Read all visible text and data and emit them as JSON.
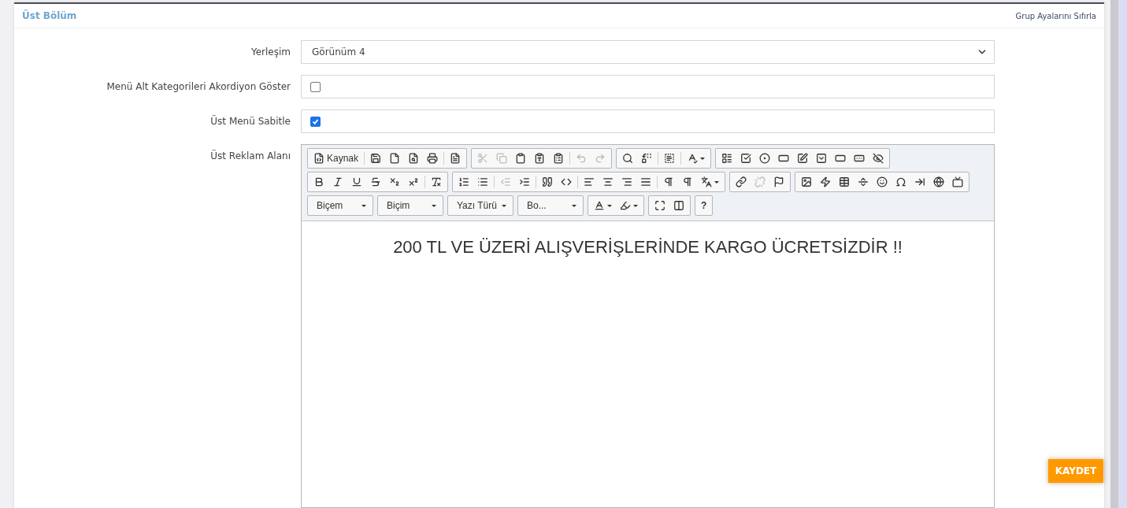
{
  "panel": {
    "title": "Üst Bölüm",
    "reset_link": "Grup Ayalarını Sıfırla"
  },
  "fields": [
    {
      "kind": "select",
      "label": "Yerleşim",
      "value": "Görünüm 4"
    },
    {
      "kind": "checkbox",
      "label": "Menü Alt Kategorileri Akordiyon Göster",
      "checked": false
    },
    {
      "kind": "checkbox",
      "label": "Üst Menü Sabitle",
      "checked": true
    },
    {
      "kind": "editor",
      "label": "Üst Reklam Alanı",
      "content": "200 TL VE ÜZERİ ALIŞVERİŞLERİNDE KARGO ÜCRETSİZDİR !!"
    }
  ],
  "toolbar_rows": [
    [
      [
        {
          "kind": "source",
          "label": "Kaynak",
          "disabled": false
        },
        {
          "kind": "sep"
        },
        {
          "kind": "save",
          "disabled": false
        },
        {
          "kind": "newpage",
          "disabled": false
        },
        {
          "kind": "preview",
          "disabled": false
        },
        {
          "kind": "print",
          "disabled": false
        },
        {
          "kind": "sep"
        },
        {
          "kind": "templates",
          "disabled": false
        }
      ],
      [
        {
          "kind": "cut",
          "disabled": true
        },
        {
          "kind": "copy",
          "disabled": true
        },
        {
          "kind": "paste",
          "disabled": false
        },
        {
          "kind": "pastetext",
          "disabled": false
        },
        {
          "kind": "pasteword",
          "disabled": false
        },
        {
          "kind": "sep"
        },
        {
          "kind": "undo",
          "disabled": true
        },
        {
          "kind": "redo",
          "disabled": true
        }
      ],
      [
        {
          "kind": "find",
          "disabled": false
        },
        {
          "kind": "replace",
          "disabled": false
        },
        {
          "kind": "sep"
        },
        {
          "kind": "selectall",
          "disabled": false
        },
        {
          "kind": "sep"
        },
        {
          "kind": "spellcheck",
          "disabled": false
        }
      ],
      [
        {
          "kind": "form",
          "disabled": false
        },
        {
          "kind": "checkbox",
          "disabled": false
        },
        {
          "kind": "radio",
          "disabled": false
        },
        {
          "kind": "textfield",
          "disabled": false
        },
        {
          "kind": "textarea",
          "disabled": false
        },
        {
          "kind": "selectfield",
          "disabled": false
        },
        {
          "kind": "button",
          "disabled": false
        },
        {
          "kind": "imagebutton",
          "disabled": false
        },
        {
          "kind": "hidden",
          "disabled": false
        }
      ]
    ],
    [
      [
        {
          "kind": "bold",
          "disabled": false
        },
        {
          "kind": "italic",
          "disabled": false
        },
        {
          "kind": "underline",
          "disabled": false
        },
        {
          "kind": "strike",
          "disabled": false
        },
        {
          "kind": "subscript",
          "disabled": false
        },
        {
          "kind": "superscript",
          "disabled": false
        },
        {
          "kind": "sep"
        },
        {
          "kind": "removeformat",
          "disabled": false
        }
      ],
      [
        {
          "kind": "numberedlist",
          "disabled": false
        },
        {
          "kind": "bulletlist",
          "disabled": false
        },
        {
          "kind": "sep"
        },
        {
          "kind": "outdent",
          "disabled": true
        },
        {
          "kind": "indent",
          "disabled": false
        },
        {
          "kind": "sep"
        },
        {
          "kind": "blockquote",
          "disabled": false
        },
        {
          "kind": "div",
          "disabled": false
        },
        {
          "kind": "sep"
        },
        {
          "kind": "alignleft",
          "disabled": false
        },
        {
          "kind": "aligncenter",
          "disabled": false
        },
        {
          "kind": "alignright",
          "disabled": false
        },
        {
          "kind": "justify",
          "disabled": false
        },
        {
          "kind": "sep"
        },
        {
          "kind": "ltr",
          "disabled": false
        },
        {
          "kind": "rtl",
          "disabled": false
        },
        {
          "kind": "language",
          "disabled": false
        }
      ],
      [
        {
          "kind": "link",
          "disabled": false
        },
        {
          "kind": "unlink",
          "disabled": true
        },
        {
          "kind": "anchor",
          "disabled": false
        }
      ],
      [
        {
          "kind": "image",
          "disabled": false
        },
        {
          "kind": "flash",
          "disabled": false
        },
        {
          "kind": "table",
          "disabled": false
        },
        {
          "kind": "hr",
          "disabled": false
        },
        {
          "kind": "smiley",
          "disabled": false
        },
        {
          "kind": "specialchar",
          "disabled": false
        },
        {
          "kind": "pagebreak",
          "disabled": false
        },
        {
          "kind": "iframe",
          "disabled": false
        },
        {
          "kind": "video",
          "disabled": false
        }
      ]
    ],
    [
      [
        {
          "kind": "combo",
          "label": "Biçem"
        }
      ],
      [
        {
          "kind": "combo",
          "label": "Biçim"
        }
      ],
      [
        {
          "kind": "combo",
          "label": "Yazı Türü"
        }
      ],
      [
        {
          "kind": "combo",
          "label": "Bo..."
        }
      ],
      [
        {
          "kind": "textcolor",
          "disabled": false
        },
        {
          "kind": "bgcolor",
          "disabled": false
        }
      ],
      [
        {
          "kind": "maximize",
          "disabled": false
        },
        {
          "kind": "showblocks",
          "disabled": false
        }
      ],
      [
        {
          "kind": "text",
          "label": "?",
          "disabled": false
        }
      ]
    ]
  ],
  "save_button": "KAYDET"
}
